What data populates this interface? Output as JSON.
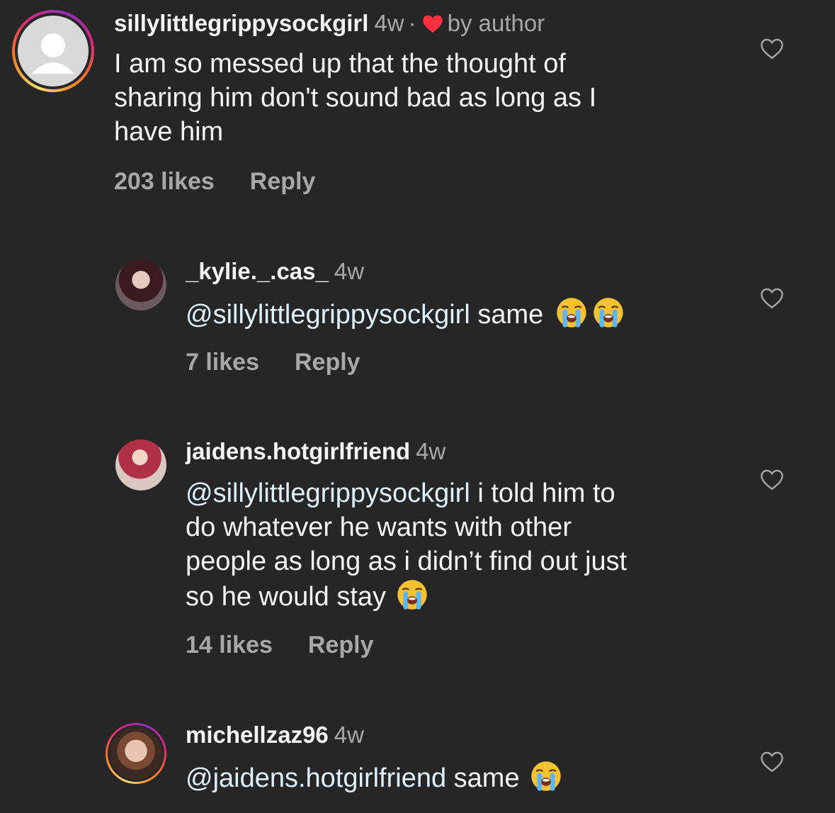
{
  "comments": [
    {
      "username": "sillylittlegrippysockgirl",
      "time": "4w",
      "dot": "·",
      "author_badge": "by author",
      "text_lines": [
        "I am so messed up that the thought of",
        "sharing him don't sound bad as long as I",
        "have him"
      ],
      "likes": "203 likes",
      "reply": "Reply"
    },
    {
      "username": "_kylie._.cas_",
      "time": "4w",
      "mention": "@sillylittlegrippysockgirl",
      "text": "same",
      "likes": "7 likes",
      "reply": "Reply"
    },
    {
      "username": "jaidens.hotgirlfriend",
      "time": "4w",
      "mention": "@sillylittlegrippysockgirl",
      "text_first": "i told him to",
      "text_lines": [
        "do whatever he wants with other",
        "people as long as i didn’t find out just",
        "so he would stay"
      ],
      "likes": "14 likes",
      "reply": "Reply"
    },
    {
      "username": "michellzaz96",
      "time": "4w",
      "mention": "@jaidens.hotgirlfriend",
      "text": "same"
    }
  ],
  "icons": {
    "like": "heart-outline-icon",
    "author_like": "heart-filled-icon",
    "emoji": "loudly-crying-face-emoji"
  },
  "colors": {
    "background": "#262626",
    "text": "#f5f5f5",
    "secondary": "#a8a8a8",
    "mention": "#e0f1ff",
    "heart": "#ff3040"
  }
}
